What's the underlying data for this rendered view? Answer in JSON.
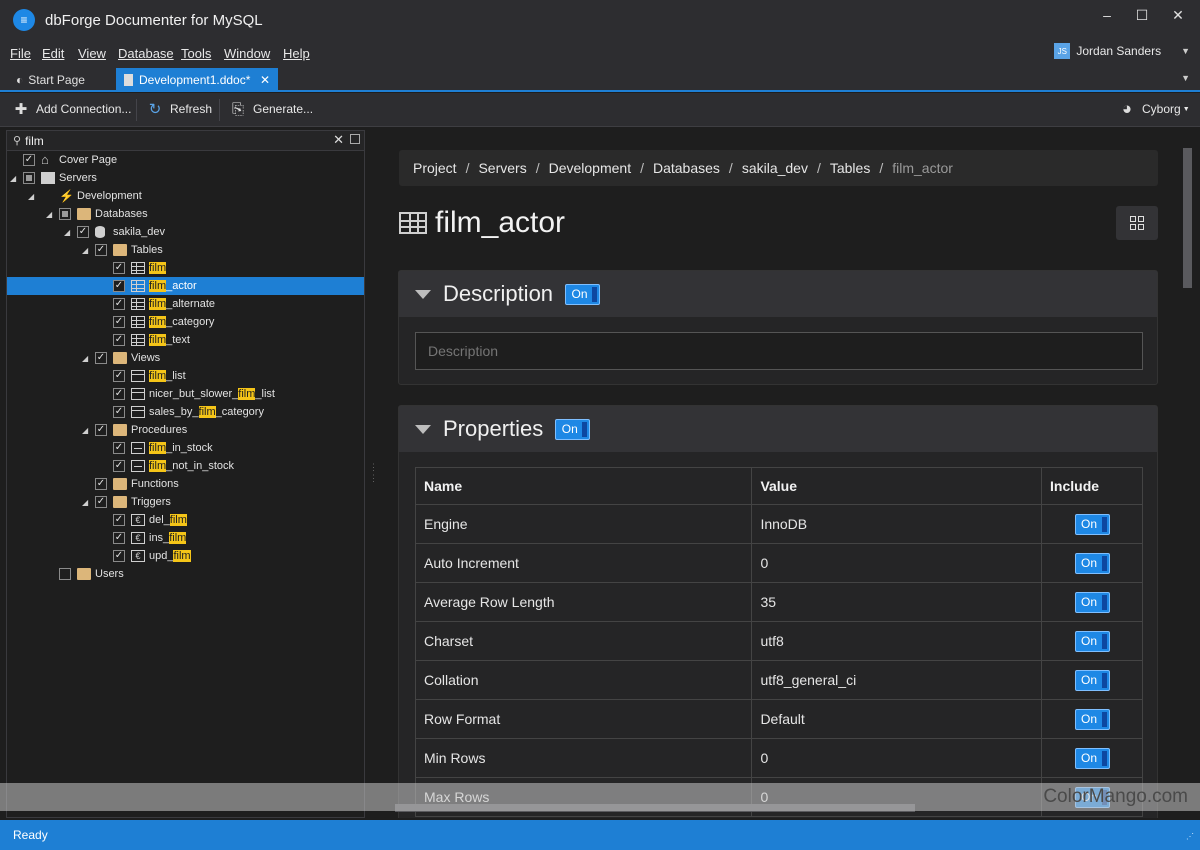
{
  "app": {
    "title": "dbForge Documenter for MySQL",
    "logo": "app-logo-icon"
  },
  "menu": [
    "File",
    "Edit",
    "View",
    "Database",
    "Tools",
    "Window",
    "Help"
  ],
  "user": {
    "initials": "JS",
    "name": "Jordan Sanders"
  },
  "tabs": {
    "start": "Start Page",
    "doc": "Development1.ddoc*"
  },
  "toolbar": {
    "add_connection": "Add Connection...",
    "refresh": "Refresh",
    "generate": "Generate...",
    "theme": "Cyborg"
  },
  "search": {
    "value": "film"
  },
  "tree": [
    {
      "label": "Cover Page",
      "checked": "full",
      "icon": "home"
    },
    {
      "label": "Servers",
      "checked": "partial",
      "icon": "server",
      "expanded": true
    },
    {
      "label": "Development",
      "checked": "none",
      "icon": "plug",
      "expanded": true
    },
    {
      "label": "Databases",
      "checked": "partial",
      "icon": "folder",
      "expanded": true
    },
    {
      "label": "sakila_dev",
      "checked": "full",
      "icon": "database",
      "expanded": true
    },
    {
      "label": "Tables",
      "checked": "full",
      "icon": "folder",
      "expanded": true
    },
    {
      "label": "film",
      "checked": "full",
      "icon": "table"
    },
    {
      "label": "film_actor",
      "checked": "full",
      "icon": "table",
      "selected": true
    },
    {
      "label": "film_alternate",
      "checked": "full",
      "icon": "table"
    },
    {
      "label": "film_category",
      "checked": "full",
      "icon": "table"
    },
    {
      "label": "film_text",
      "checked": "full",
      "icon": "table"
    },
    {
      "label": "Views",
      "checked": "full",
      "icon": "folder",
      "expanded": true
    },
    {
      "label": "film_list",
      "checked": "full",
      "icon": "view"
    },
    {
      "label": "nicer_but_slower_film_list",
      "checked": "full",
      "icon": "view"
    },
    {
      "label": "sales_by_film_category",
      "checked": "full",
      "icon": "view"
    },
    {
      "label": "Procedures",
      "checked": "full",
      "icon": "folder",
      "expanded": true
    },
    {
      "label": "film_in_stock",
      "checked": "full",
      "icon": "procedure"
    },
    {
      "label": "film_not_in_stock",
      "checked": "full",
      "icon": "procedure"
    },
    {
      "label": "Functions",
      "checked": "full",
      "icon": "folder"
    },
    {
      "label": "Triggers",
      "checked": "full",
      "icon": "folder",
      "expanded": true
    },
    {
      "label": "del_film",
      "checked": "full",
      "icon": "trigger"
    },
    {
      "label": "ins_film",
      "checked": "full",
      "icon": "trigger"
    },
    {
      "label": "upd_film",
      "checked": "full",
      "icon": "trigger"
    },
    {
      "label": "Users",
      "checked": "empty",
      "icon": "folder"
    }
  ],
  "breadcrumb": [
    "Project",
    "Servers",
    "Development",
    "Databases",
    "sakila_dev",
    "Tables",
    "film_actor"
  ],
  "page_title": "film_actor",
  "description": {
    "title": "Description",
    "toggle": "On",
    "placeholder": "Description"
  },
  "properties": {
    "title": "Properties",
    "toggle": "On",
    "columns": [
      "Name",
      "Value",
      "Include"
    ],
    "rows": [
      {
        "name": "Engine",
        "value": "InnoDB",
        "include": "On"
      },
      {
        "name": "Auto Increment",
        "value": "0",
        "include": "On"
      },
      {
        "name": "Average Row Length",
        "value": "35",
        "include": "On"
      },
      {
        "name": "Charset",
        "value": "utf8",
        "include": "On"
      },
      {
        "name": "Collation",
        "value": "utf8_general_ci",
        "include": "On"
      },
      {
        "name": "Row Format",
        "value": "Default",
        "include": "On"
      },
      {
        "name": "Min Rows",
        "value": "0",
        "include": "On"
      },
      {
        "name": "Max Rows",
        "value": "0",
        "include": "On"
      }
    ]
  },
  "status": "Ready",
  "watermark": "ColorMango.com"
}
